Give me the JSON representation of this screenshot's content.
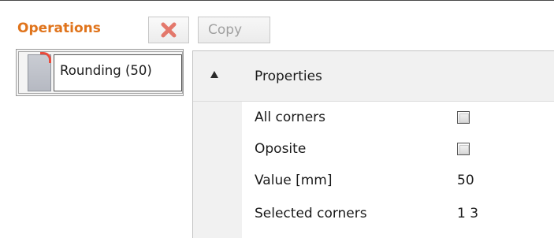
{
  "toolbar": {
    "title": "Operations",
    "delete_icon": "red-x-icon",
    "copy_label": "Copy"
  },
  "operations": [
    {
      "label": "Rounding  (50)",
      "thumbnail_icon": "rounded-corner-panel-icon",
      "selected": true
    }
  ],
  "properties": {
    "header": "Properties",
    "expanded": true,
    "rows": [
      {
        "name": "All corners",
        "type": "checkbox",
        "checked": false
      },
      {
        "name": "Oposite",
        "type": "checkbox",
        "checked": false
      },
      {
        "name": "Value [mm]",
        "type": "text",
        "value": "50"
      },
      {
        "name": "Selected corners",
        "type": "text",
        "value": "1 3"
      }
    ]
  },
  "colors": {
    "title": "#e0741c",
    "delete_icon": "#e05a4a",
    "disabled_text": "#a0a0a0"
  }
}
